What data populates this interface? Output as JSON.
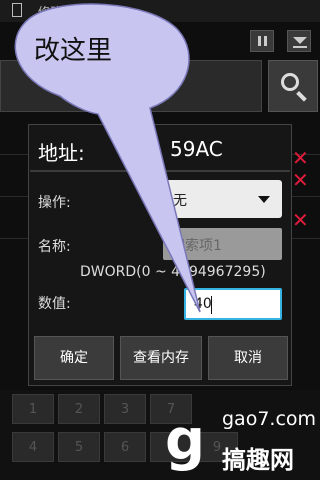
{
  "app": {
    "title": "修改器"
  },
  "toolbar": {
    "pause_icon": "pause-icon",
    "collapse_icon": "collapse-icon",
    "search_icon": "search-icon"
  },
  "dialog": {
    "title_label": "地址:",
    "title_address": "59AC",
    "operation_label": "操作:",
    "operation_value": "无",
    "name_label": "名称:",
    "name_placeholder": "搜索项1",
    "type_range": "DWORD(0 ~ 4294967295)",
    "value_label": "数值:",
    "value": "40",
    "buttons": {
      "ok": "确定",
      "view_memory": "查看内存",
      "cancel": "取消"
    }
  },
  "keypad": {
    "keys": [
      "1",
      "2",
      "3",
      "4",
      "5",
      "6",
      "7",
      "8",
      "9"
    ]
  },
  "annotation": {
    "text": "改这里"
  },
  "watermark": {
    "letter": "g",
    "url": "gao7.com",
    "name": "搞趣网"
  },
  "colors": {
    "accent": "#35b3e3",
    "delete": "#e01b3c",
    "bubble": "#c8c6f0"
  }
}
